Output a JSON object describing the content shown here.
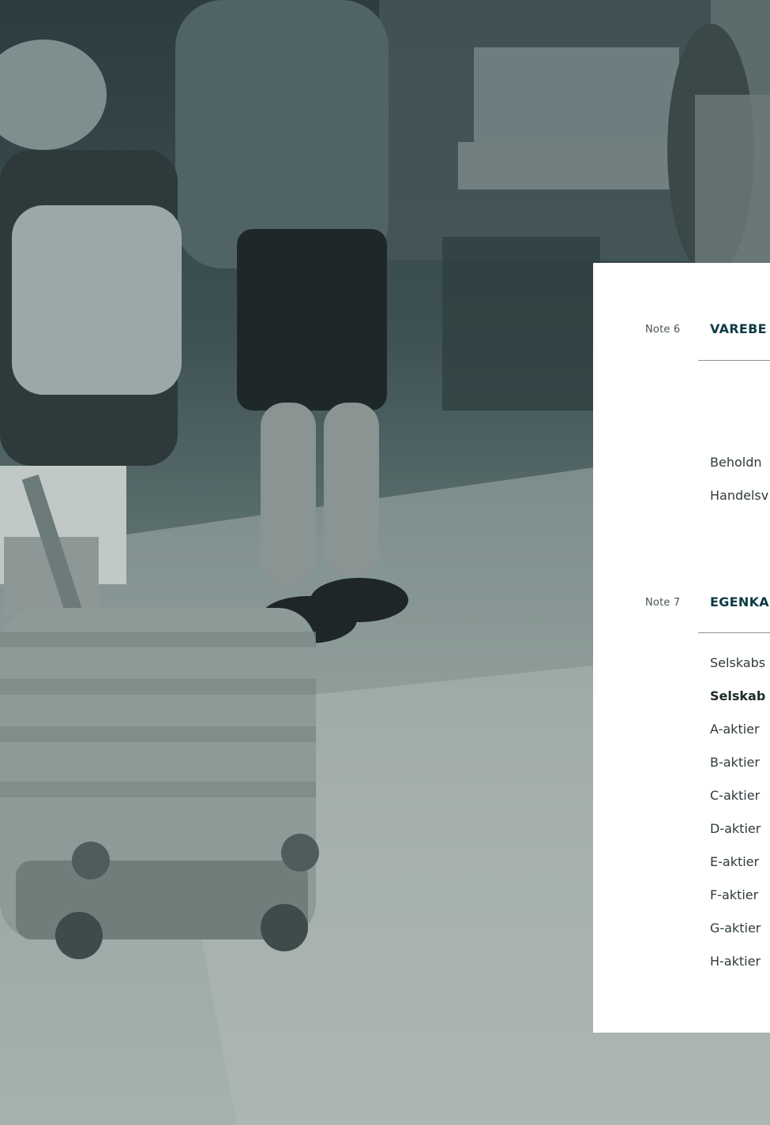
{
  "notes": [
    {
      "number_label": "Note 6",
      "title": "VAREBE",
      "rows": [
        {
          "label": "Beholdn",
          "bold": false
        },
        {
          "label": "Handelsv",
          "bold": false
        }
      ]
    },
    {
      "number_label": "Note 7",
      "title": "EGENKA",
      "rows": [
        {
          "label": "Selskabs",
          "bold": false
        },
        {
          "label": "Selskab",
          "bold": true
        },
        {
          "label": "A-aktier",
          "bold": false
        },
        {
          "label": "B-aktier",
          "bold": false
        },
        {
          "label": "C-aktier",
          "bold": false
        },
        {
          "label": "D-aktier",
          "bold": false
        },
        {
          "label": "E-aktier",
          "bold": false
        },
        {
          "label": "F-aktier",
          "bold": false
        },
        {
          "label": "G-aktier",
          "bold": false
        },
        {
          "label": "H-aktier",
          "bold": false
        }
      ]
    }
  ]
}
